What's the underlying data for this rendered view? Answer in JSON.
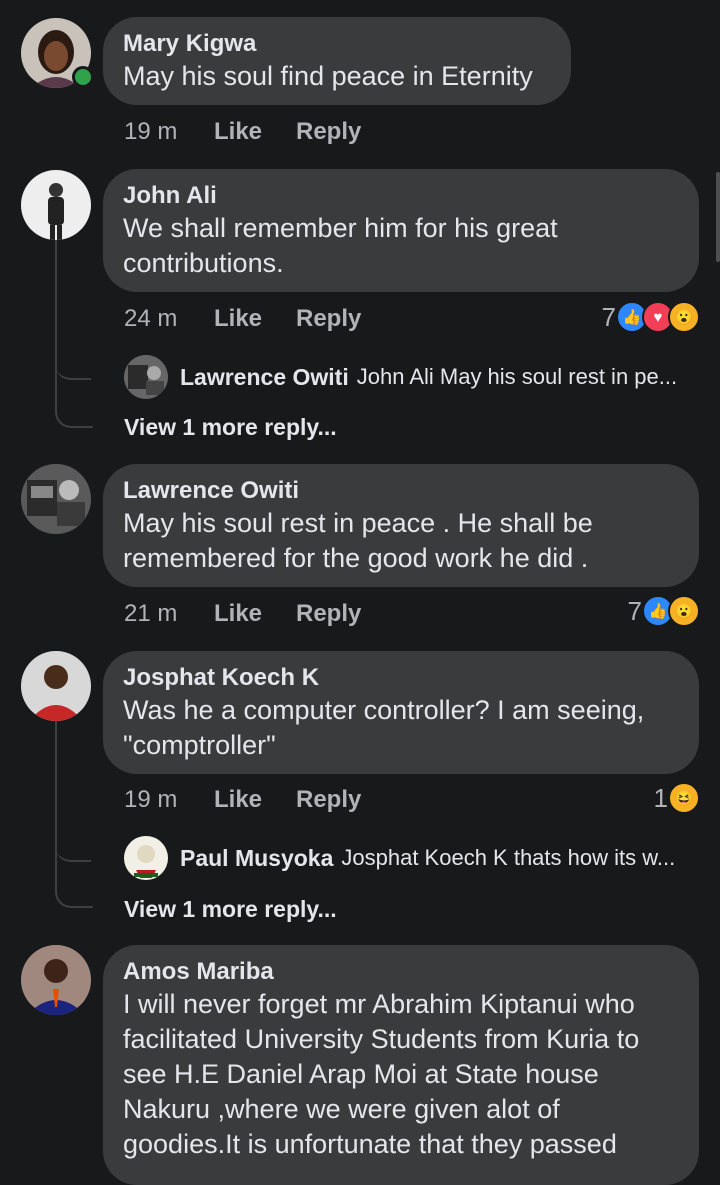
{
  "comments": [
    {
      "author": "Mary Kigwa",
      "text": "May his soul find peace in Eternity",
      "time": "19 m",
      "like": "Like",
      "reply": "Reply"
    },
    {
      "author": "John Ali",
      "text_lines": [
        "We shall remember him for his great",
        "contributions."
      ],
      "time": "24 m",
      "like": "Like",
      "reply": "Reply",
      "reaction_count": "7",
      "reactions": [
        "like",
        "love",
        "wow"
      ],
      "sub_reply": {
        "author": "Lawrence Owiti",
        "text": "John Ali May his soul rest in pe..."
      },
      "view_more": "View 1 more reply..."
    },
    {
      "author": "Lawrence Owiti",
      "text_lines": [
        "May his soul rest in peace . He shall be",
        "remembered for the good work he did ."
      ],
      "time": "21 m",
      "like": "Like",
      "reply": "Reply",
      "reaction_count": "7",
      "reactions": [
        "like",
        "wow"
      ]
    },
    {
      "author": "Josphat Koech K",
      "text_lines": [
        "Was he a computer controller? I am seeing,",
        "\"comptroller\""
      ],
      "time": "19 m",
      "like": "Like",
      "reply": "Reply",
      "reaction_count": "1",
      "reactions": [
        "haha"
      ],
      "sub_reply": {
        "author": "Paul Musyoka",
        "text": "Josphat Koech K thats how its w..."
      },
      "view_more": "View 1 more reply..."
    },
    {
      "author": "Amos Mariba",
      "text_lines": [
        "I will never forget mr Abrahim Kiptanui who",
        "facilitated University Students from Kuria to",
        "see H.E Daniel Arap Moi at State house",
        "Nakuru ,where we were given alot of",
        "goodies.It  is  unfortunate  that they passed"
      ]
    }
  ],
  "colors": {
    "background": "#18191a",
    "bubble": "#3a3b3c",
    "like_blue": "#2d88ff",
    "love_red": "#f33e58",
    "wow_yellow": "#f7b125",
    "online_green": "#31a24c"
  }
}
